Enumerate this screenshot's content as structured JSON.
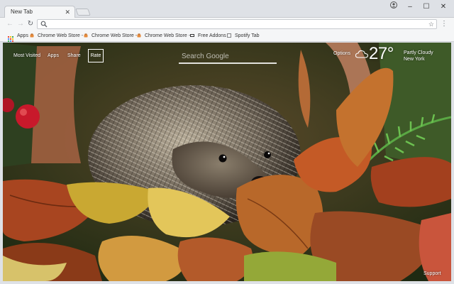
{
  "browser": {
    "tab_title": "New Tab",
    "tab_close": "✕",
    "window_controls": {
      "minimize": "–",
      "maximize": "☐",
      "close": "✕"
    },
    "omnibox": {
      "value": "",
      "placeholder": ""
    }
  },
  "bookmarks": {
    "apps": "Apps",
    "items": [
      {
        "label": "Chrome Web Store -",
        "icon": "chrome-web-store-icon"
      },
      {
        "label": "Chrome Web Store -",
        "icon": "chrome-web-store-icon"
      },
      {
        "label": "Chrome Web Store -",
        "icon": "chrome-web-store-icon"
      },
      {
        "label": "Free Addons",
        "icon": "addons-icon"
      },
      {
        "label": "Spotify Tab",
        "icon": "page-icon"
      }
    ]
  },
  "newtab": {
    "nav": [
      "Most Visited",
      "Apps",
      "Share",
      "Rate"
    ],
    "search_placeholder": "Search Google",
    "options_label": "Options",
    "weather": {
      "temperature": "27°",
      "condition": "Partly Cloudy",
      "location": "New York",
      "icon": "partly-cloudy-icon"
    },
    "support_label": "Support"
  },
  "colors": {
    "chrome_bg": "#dee1e6",
    "toolbar_bg": "#f5f6f7",
    "accent_text": "#ffffff"
  }
}
